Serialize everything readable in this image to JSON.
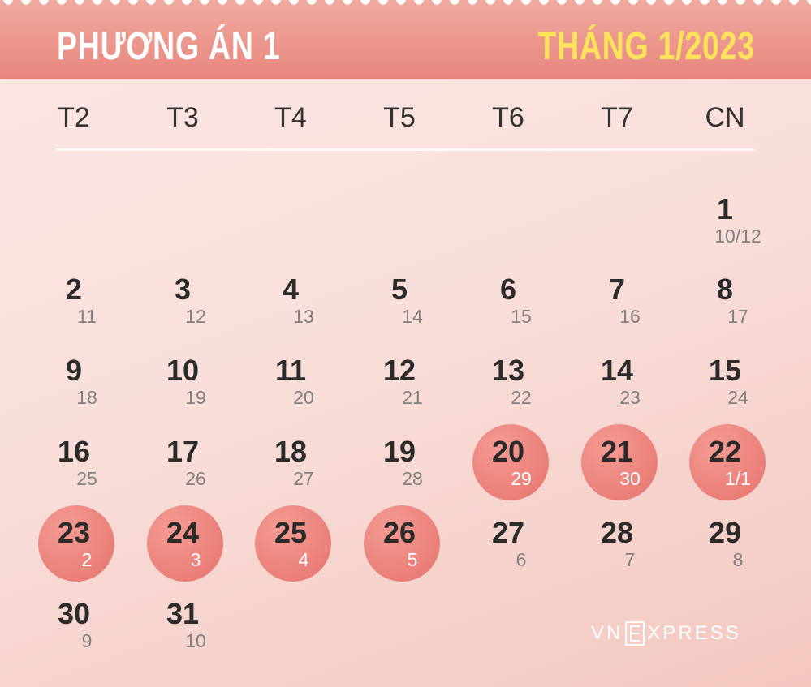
{
  "header": {
    "title": "PHƯƠNG ÁN 1",
    "month": "THÁNG 1/2023"
  },
  "weekdays": [
    "T2",
    "T3",
    "T4",
    "T5",
    "T6",
    "T7",
    "CN"
  ],
  "days": [
    {
      "day": "1",
      "lunar": "10/12",
      "highlight": false
    },
    {
      "day": "2",
      "lunar": "11",
      "highlight": false
    },
    {
      "day": "3",
      "lunar": "12",
      "highlight": false
    },
    {
      "day": "4",
      "lunar": "13",
      "highlight": false
    },
    {
      "day": "5",
      "lunar": "14",
      "highlight": false
    },
    {
      "day": "6",
      "lunar": "15",
      "highlight": false
    },
    {
      "day": "7",
      "lunar": "16",
      "highlight": false
    },
    {
      "day": "8",
      "lunar": "17",
      "highlight": false
    },
    {
      "day": "9",
      "lunar": "18",
      "highlight": false
    },
    {
      "day": "10",
      "lunar": "19",
      "highlight": false
    },
    {
      "day": "11",
      "lunar": "20",
      "highlight": false
    },
    {
      "day": "12",
      "lunar": "21",
      "highlight": false
    },
    {
      "day": "13",
      "lunar": "22",
      "highlight": false
    },
    {
      "day": "14",
      "lunar": "23",
      "highlight": false
    },
    {
      "day": "15",
      "lunar": "24",
      "highlight": false
    },
    {
      "day": "16",
      "lunar": "25",
      "highlight": false
    },
    {
      "day": "17",
      "lunar": "26",
      "highlight": false
    },
    {
      "day": "18",
      "lunar": "27",
      "highlight": false
    },
    {
      "day": "19",
      "lunar": "28",
      "highlight": false
    },
    {
      "day": "20",
      "lunar": "29",
      "highlight": true
    },
    {
      "day": "21",
      "lunar": "30",
      "highlight": true
    },
    {
      "day": "22",
      "lunar": "1/1",
      "highlight": true
    },
    {
      "day": "23",
      "lunar": "2",
      "highlight": true
    },
    {
      "day": "24",
      "lunar": "3",
      "highlight": true
    },
    {
      "day": "25",
      "lunar": "4",
      "highlight": true
    },
    {
      "day": "26",
      "lunar": "5",
      "highlight": true
    },
    {
      "day": "27",
      "lunar": "6",
      "highlight": false
    },
    {
      "day": "28",
      "lunar": "7",
      "highlight": false
    },
    {
      "day": "29",
      "lunar": "8",
      "highlight": false
    },
    {
      "day": "30",
      "lunar": "9",
      "highlight": false
    },
    {
      "day": "31",
      "lunar": "10",
      "highlight": false
    }
  ],
  "first_weekday_index": 6,
  "brand": {
    "left": "VN",
    "right": "XPRESS"
  },
  "colors": {
    "header_bg": "#e98a82",
    "title_text": "#ffffff",
    "month_text": "#ffe35a",
    "highlight_circle": "#ea7f78"
  }
}
